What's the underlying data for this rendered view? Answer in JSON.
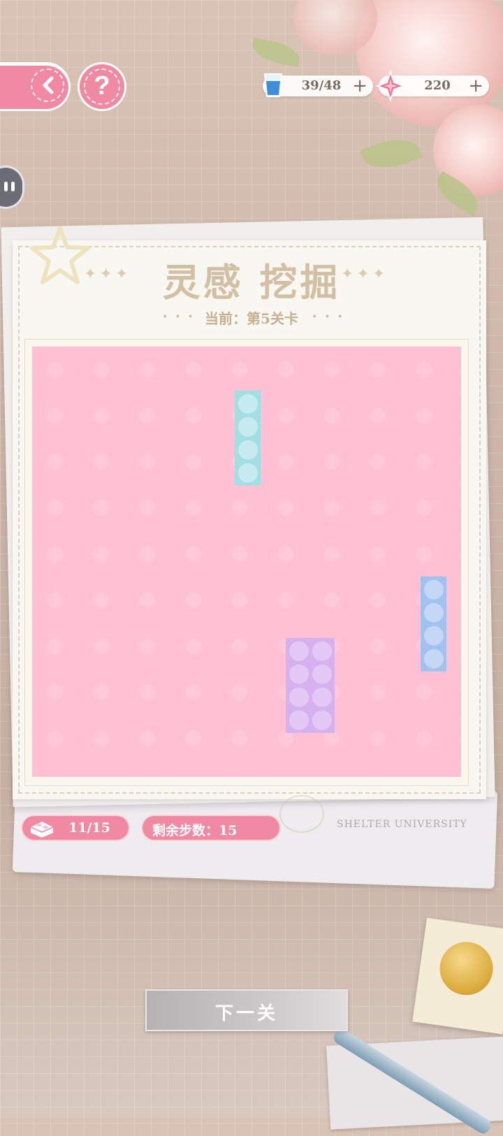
{
  "topbar": {
    "back_icon": "chevron-left-icon",
    "help_label": "?",
    "energy": {
      "icon": "water-cup-icon",
      "value": "39/48",
      "plus": "+"
    },
    "gems": {
      "icon": "pink-star-gem-icon",
      "value": "220",
      "plus": "+"
    }
  },
  "card": {
    "title": "灵感 挖掘",
    "subtitle": "当前：第5关卡"
  },
  "board": {
    "background_color": "#fec0d2",
    "pieces": [
      {
        "name": "teal-brick",
        "color": "#a2dee2",
        "dot_color": "#c6ecef",
        "cols": 1,
        "rows": 4
      },
      {
        "name": "blue-brick",
        "color": "#a2c1ee",
        "dot_color": "#c4d8f6",
        "cols": 1,
        "rows": 4
      },
      {
        "name": "purple-brick",
        "color": "#d6b1f0",
        "dot_color": "#e4c9f6",
        "cols": 2,
        "rows": 4
      }
    ]
  },
  "status": {
    "bricks_icon": "brick-icon",
    "bricks_count": "11/15",
    "steps_remaining": "剩余步数：15",
    "university_text": "SHELTER UNIVERSITY"
  },
  "next_button": {
    "label": "下一关"
  },
  "colors": {
    "accent_pink": "#f08aa2",
    "title_gold": "#d3c0a4"
  }
}
